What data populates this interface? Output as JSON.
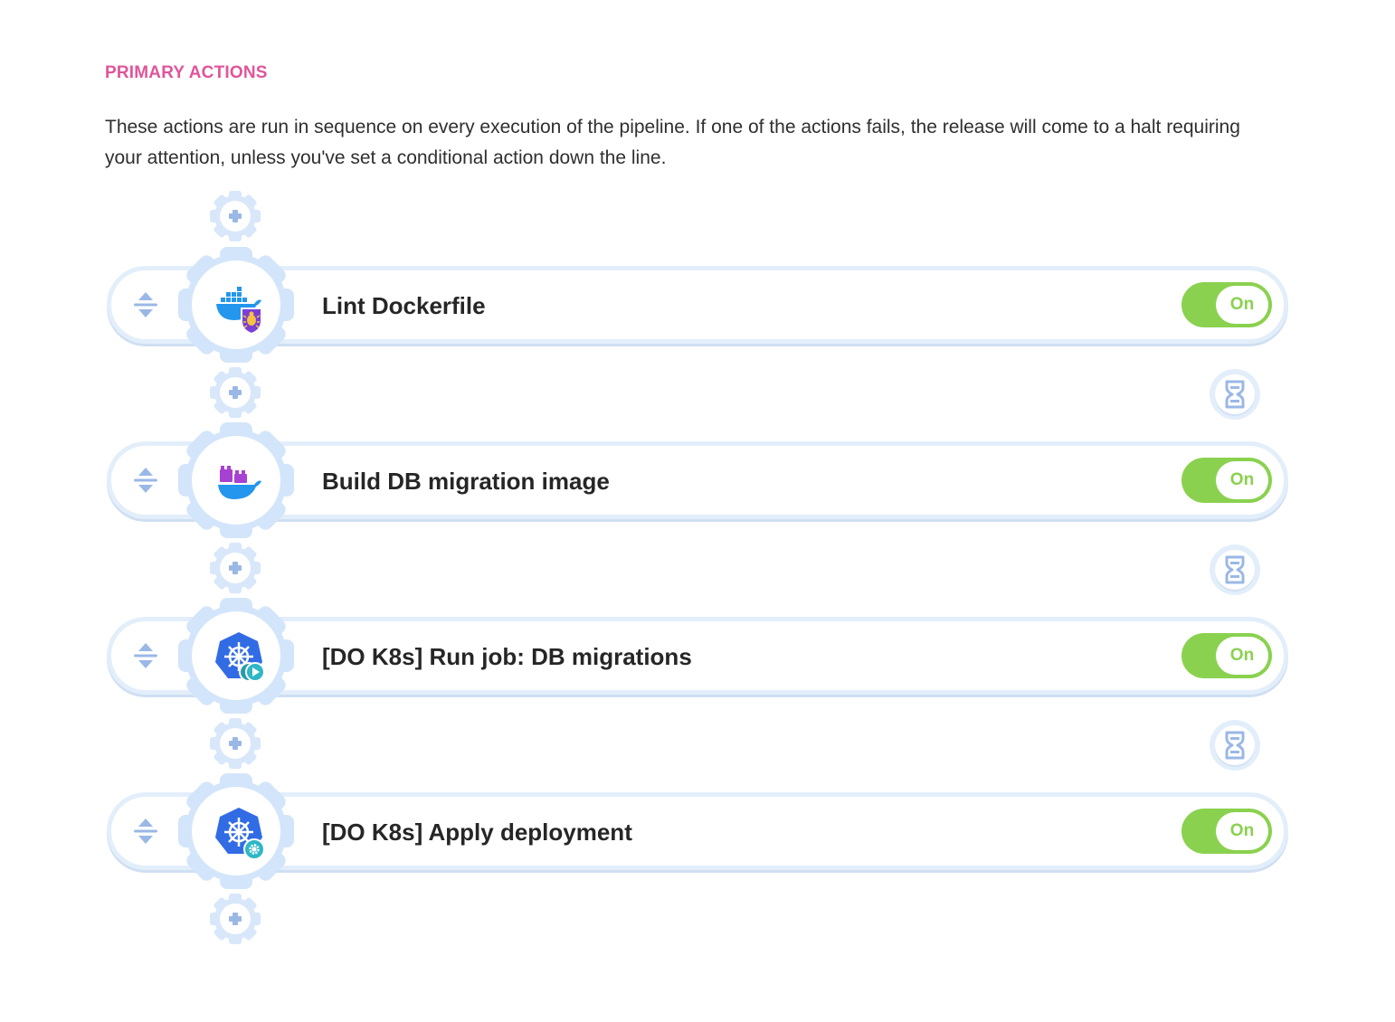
{
  "section": {
    "title": "PRIMARY ACTIONS",
    "description": "These actions are run in sequence on every execution of the pipeline. If one of the actions fails, the release will come to a halt requiring your attention, unless you've set a conditional action down the line."
  },
  "colors": {
    "title_accent": "#e0559a",
    "toggle_on": "#8ad14f",
    "gear": "#d3e5fa",
    "icon_blue": "#9ab8e6",
    "docker_blue": "#2496ed",
    "k8s_blue": "#326ce5",
    "teal_badge": "#2fb7c6",
    "purple": "#a741d1"
  },
  "actions": [
    {
      "name": "Lint Dockerfile",
      "icon": "docker-lint-icon",
      "badge": "bug-shield-icon",
      "toggle_label": "On",
      "enabled": true
    },
    {
      "name": "Build DB migration image",
      "icon": "docker-build-icon",
      "badge": "",
      "toggle_label": "On",
      "enabled": true
    },
    {
      "name": "[DO K8s] Run job: DB migrations",
      "icon": "kubernetes-icon",
      "badge": "play-job-icon",
      "toggle_label": "On",
      "enabled": true
    },
    {
      "name": "[DO K8s] Apply deployment",
      "icon": "kubernetes-icon",
      "badge": "gear-badge-icon",
      "toggle_label": "On",
      "enabled": true
    }
  ],
  "icons": {
    "add": "plus-icon",
    "drag": "drag-handle-icon",
    "delay": "hourglass-icon"
  }
}
